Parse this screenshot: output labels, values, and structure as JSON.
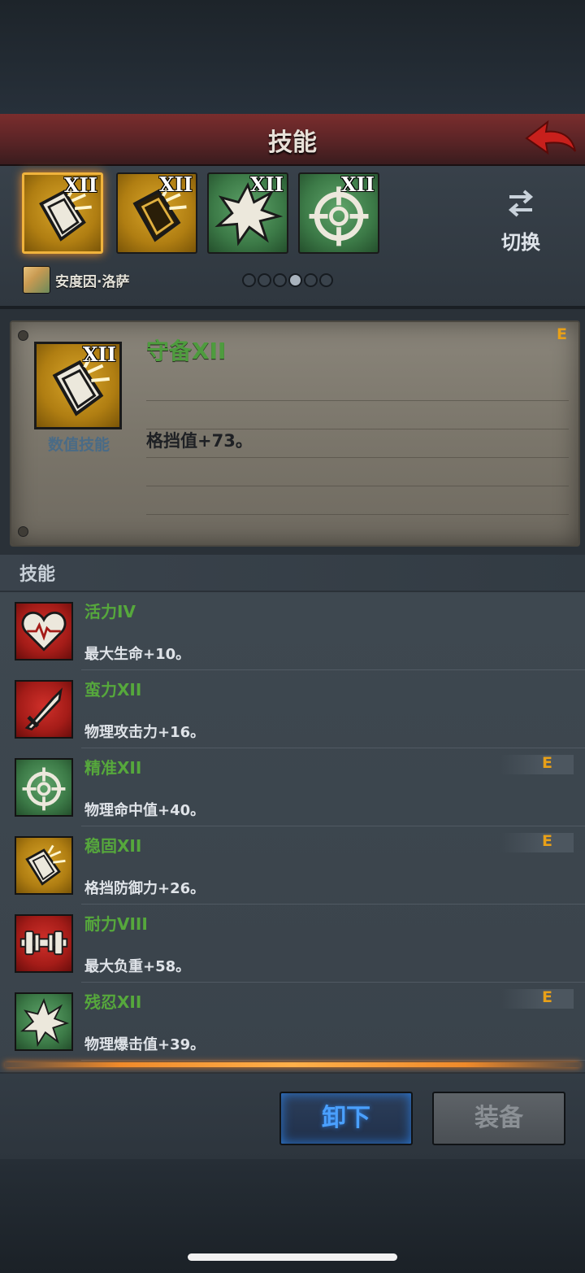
{
  "header": {
    "title": "技能"
  },
  "slots": [
    {
      "level": "XII",
      "icon": "shield-icon"
    },
    {
      "level": "XII",
      "icon": "shield-icon"
    },
    {
      "level": "XII",
      "icon": "burst-icon"
    },
    {
      "level": "XII",
      "icon": "crosshair-icon"
    }
  ],
  "switch": {
    "label": "切换",
    "icon": "swap-arrows-icon"
  },
  "hero": {
    "name": "安度因·洛萨"
  },
  "pagination": {
    "count": 6,
    "active": 4
  },
  "detail": {
    "level": "XII",
    "type": "数值技能",
    "name": "守备XII",
    "description": "格挡值+73。",
    "equipped_mark": "E"
  },
  "section": {
    "title": "技能"
  },
  "skills": [
    {
      "name": "活力IV",
      "description": "最大生命+10。",
      "icon": "heart-icon",
      "color": "red",
      "equipped": ""
    },
    {
      "name": "蛮力XII",
      "description": "物理攻击力+16。",
      "icon": "sword-icon",
      "color": "red",
      "equipped": ""
    },
    {
      "name": "精准XII",
      "description": "物理命中值+40。",
      "icon": "crosshair-icon",
      "color": "green",
      "equipped": "E"
    },
    {
      "name": "稳固XII",
      "description": "格挡防御力+26。",
      "icon": "shield-icon",
      "color": "gold",
      "equipped": "E"
    },
    {
      "name": "耐力VIII",
      "description": "最大负重+58。",
      "icon": "dumbbell-icon",
      "color": "red",
      "equipped": ""
    },
    {
      "name": "残忍XII",
      "description": "物理爆击值+39。",
      "icon": "burst-icon",
      "color": "green",
      "equipped": "E"
    }
  ],
  "buttons": {
    "unequip": "卸下",
    "equip": "装备"
  }
}
